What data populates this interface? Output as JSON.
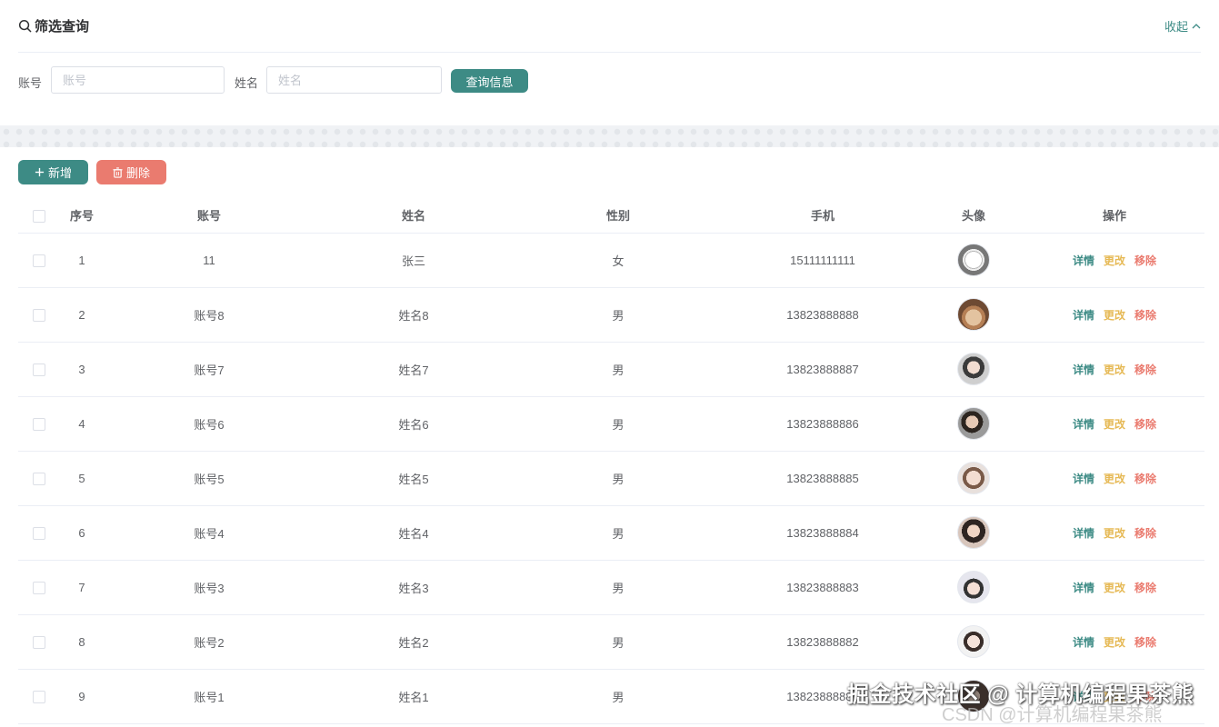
{
  "filter": {
    "title": "筛选查询",
    "collapse_label": "收起",
    "account_label": "账号",
    "account_placeholder": "账号",
    "name_label": "姓名",
    "name_placeholder": "姓名",
    "query_button": "查询信息"
  },
  "toolbar": {
    "add_label": "新增",
    "delete_label": "删除"
  },
  "table": {
    "headers": {
      "index": "序号",
      "account": "账号",
      "name": "姓名",
      "gender": "性别",
      "phone": "手机",
      "avatar": "头像",
      "actions": "操作"
    },
    "rows": [
      {
        "index": "1",
        "account": "11",
        "name": "张三",
        "gender": "女",
        "phone": "15111111111",
        "avatar": "laptop-avatar"
      },
      {
        "index": "2",
        "account": "账号8",
        "name": "姓名8",
        "gender": "男",
        "phone": "13823888888",
        "avatar": "cat-avatar"
      },
      {
        "index": "3",
        "account": "账号7",
        "name": "姓名7",
        "gender": "男",
        "phone": "13823888887",
        "avatar": "person-avatar"
      },
      {
        "index": "4",
        "account": "账号6",
        "name": "姓名6",
        "gender": "男",
        "phone": "13823888886",
        "avatar": "person-avatar"
      },
      {
        "index": "5",
        "account": "账号5",
        "name": "姓名5",
        "gender": "男",
        "phone": "13823888885",
        "avatar": "person-avatar"
      },
      {
        "index": "6",
        "account": "账号4",
        "name": "姓名4",
        "gender": "男",
        "phone": "13823888884",
        "avatar": "person-avatar"
      },
      {
        "index": "7",
        "account": "账号3",
        "name": "姓名3",
        "gender": "男",
        "phone": "13823888883",
        "avatar": "person-avatar"
      },
      {
        "index": "8",
        "account": "账号2",
        "name": "姓名2",
        "gender": "男",
        "phone": "13823888882",
        "avatar": "person-avatar"
      },
      {
        "index": "9",
        "account": "账号1",
        "name": "姓名1",
        "gender": "男",
        "phone": "13823888881",
        "avatar": "person-avatar"
      }
    ],
    "actions": {
      "detail": "详情",
      "edit": "更改",
      "remove": "移除"
    }
  },
  "watermark": {
    "line1": "掘金技术社区 @ 计算机编程果茶熊",
    "line2": "CSDN @计算机编程果茶熊"
  },
  "colors": {
    "primary": "#3d8b85",
    "danger": "#ea7b6f",
    "warning": "#e6b955"
  },
  "icons": {
    "search": "search-icon",
    "collapse": "chevron-up-icon",
    "add": "plus-icon",
    "delete": "trash-icon"
  }
}
